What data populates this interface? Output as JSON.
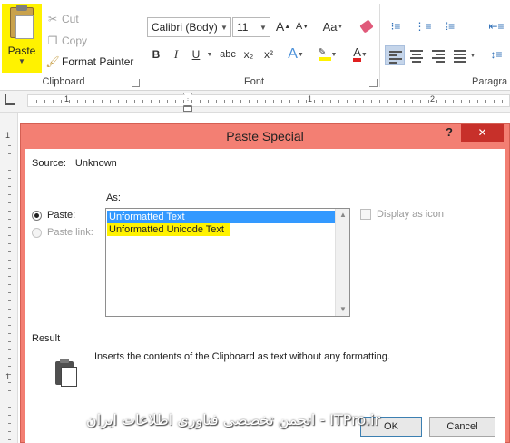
{
  "ribbon": {
    "clipboard": {
      "paste_label": "Paste",
      "cut_label": "Cut",
      "copy_label": "Copy",
      "format_painter_label": "Format Painter",
      "group_label": "Clipboard"
    },
    "font": {
      "font_name": "Calibri (Body)",
      "font_size": "11",
      "grow_font": "A",
      "shrink_font": "A",
      "change_case": "Aa",
      "bold": "B",
      "italic": "I",
      "underline": "U",
      "strikethrough": "abc",
      "subscript": "x₂",
      "superscript": "x²",
      "text_effects": "A",
      "font_color": "A",
      "group_label": "Font"
    },
    "paragraph": {
      "group_label": "Paragra"
    }
  },
  "ruler": {
    "numbers": [
      "1",
      "1",
      "2"
    ],
    "vertical_numbers": [
      "1",
      "1"
    ]
  },
  "dialog": {
    "title": "Paste Special",
    "help": "?",
    "close": "✕",
    "source_label": "Source:",
    "source_value": "Unknown",
    "as_label": "As:",
    "paste_radio_label": "Paste:",
    "paste_link_radio_label": "Paste link:",
    "list_items": [
      "Unformatted Text",
      "Unformatted Unicode Text"
    ],
    "display_as_icon_label": "Display as icon",
    "result_label": "Result",
    "result_text": "Inserts the contents of the Clipboard as text without any formatting.",
    "ok_label": "OK",
    "cancel_label": "Cancel"
  },
  "watermark": {
    "text": "ITPro.ir - انجمن تخصصی فناوری اطلاعات ایران"
  },
  "colors": {
    "highlight_yellow": "#fff200",
    "dialog_border": "#f37f73",
    "close_red": "#c7302a",
    "selection_blue": "#3399ff"
  }
}
